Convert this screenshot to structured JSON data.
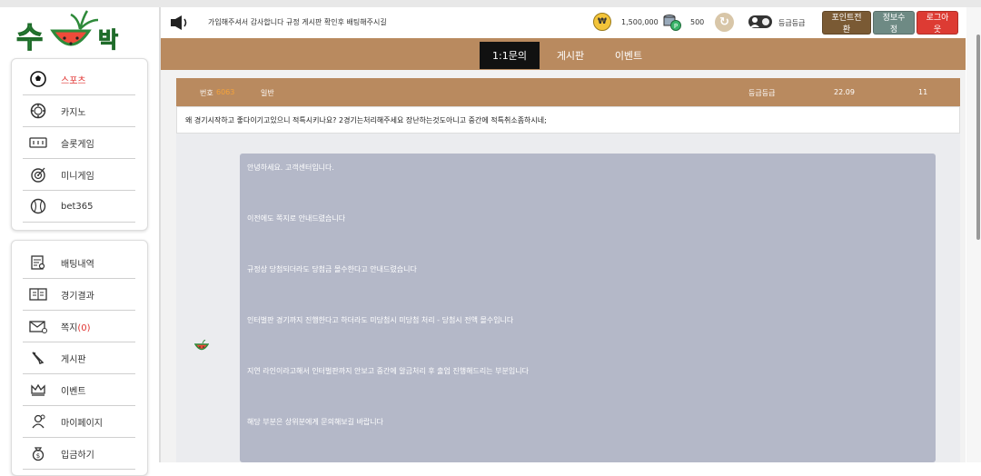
{
  "logo": {
    "text": "수박"
  },
  "sidebar": {
    "group1": [
      {
        "label": "스포츠",
        "icon": "soccer-ball-icon",
        "active": true
      },
      {
        "label": "카지노",
        "icon": "casino-chip-icon"
      },
      {
        "label": "슬롯게임",
        "icon": "slot-machine-icon"
      },
      {
        "label": "미니게임",
        "icon": "target-icon"
      },
      {
        "label": "bet365",
        "icon": "baseball-icon"
      }
    ],
    "group2": [
      {
        "label": "배팅내역",
        "icon": "history-list-icon"
      },
      {
        "label": "경기결과",
        "icon": "book-results-icon"
      },
      {
        "label": "쪽지",
        "count": "(0)",
        "icon": "envelope-icon"
      },
      {
        "label": "게시판",
        "icon": "pencil-icon"
      },
      {
        "label": "이벤트",
        "icon": "crown-icon"
      },
      {
        "label": "마이페이지",
        "icon": "user-settings-icon"
      },
      {
        "label": "입금하기",
        "icon": "money-bag-icon"
      }
    ]
  },
  "header": {
    "notice": "가입해주셔서 감사합니다 규정 게시판 확인후 배팅해주시길",
    "money_symbol": "₩",
    "money": "1,500,000",
    "point": "500",
    "level": "등급등급",
    "buttons": {
      "point_convert": "포인트전환",
      "edit_info": "정보수정",
      "logout": "로그아웃"
    }
  },
  "nav": {
    "tabs": [
      "1:1문의",
      "게시판",
      "이벤트"
    ]
  },
  "post": {
    "no_label": "번호",
    "no_value": "6063",
    "type": "일반",
    "level": "등급등급",
    "date": "22.09",
    "count": "11",
    "body": "왜 경기시작하고 좋다이기고있으니 적특시키나요? 2경기는처리해주세요 장난하는것도아니고 중간에 적특취소좀하시네;"
  },
  "answer": {
    "lines": [
      "안녕하세요. 고객센터입니다.",
      "이전에도 쪽지로 안내드렸습니다",
      "규정상 당첨되더라도 당첨금 몰수한다고 안내드렸습니다",
      "인터벌판 경기까지 진행한다고 하더라도 미당첨시 미당첨 처리 - 당첨시 전액 몰수입니다",
      "지연 라인이라고해서 인터벌판까지 안보고 중간에 알금처리 후 출업 진행해드리는 부분입니다",
      "해당 부분은 상위분에게 문의해보길 바랍니다"
    ]
  },
  "colors": {
    "brown": "#b98a5f",
    "answer_bg": "#b4b8c8",
    "accent_red": "#e0312f",
    "orange": "#f4a23a"
  }
}
